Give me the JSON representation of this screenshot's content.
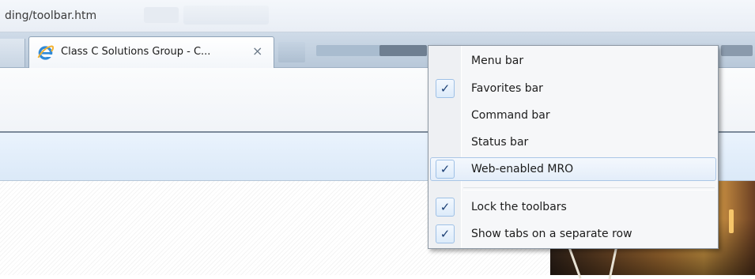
{
  "address_bar": {
    "url_text": "ding/toolbar.htm"
  },
  "tabs": [
    {
      "title": "Class C Solutions Group - C...",
      "active": true,
      "close_label": "×"
    }
  ],
  "context_menu": {
    "items": [
      {
        "label": "Menu bar",
        "checked": false,
        "check_glyph": ""
      },
      {
        "label": "Favorites bar",
        "checked": true,
        "check_glyph": "✓"
      },
      {
        "label": "Command bar",
        "checked": false,
        "check_glyph": ""
      },
      {
        "label": "Status bar",
        "checked": false,
        "check_glyph": ""
      },
      {
        "label": "Web-enabled MRO",
        "checked": true,
        "check_glyph": "✓",
        "highlighted": true
      }
    ],
    "lock_items": [
      {
        "label": "Lock the toolbars",
        "checked": true,
        "check_glyph": "✓"
      },
      {
        "label": "Show tabs on a separate row",
        "checked": true,
        "check_glyph": "✓"
      }
    ]
  },
  "icons": {
    "tab_favicon": "internet-explorer-icon",
    "check": "checkmark-icon",
    "close": "close-icon"
  },
  "colors": {
    "menu_background": "#f6f7f9",
    "menu_highlight": "#e3edf9",
    "favorites_band": "#dbe9f8",
    "check_color": "#1b3f74"
  }
}
